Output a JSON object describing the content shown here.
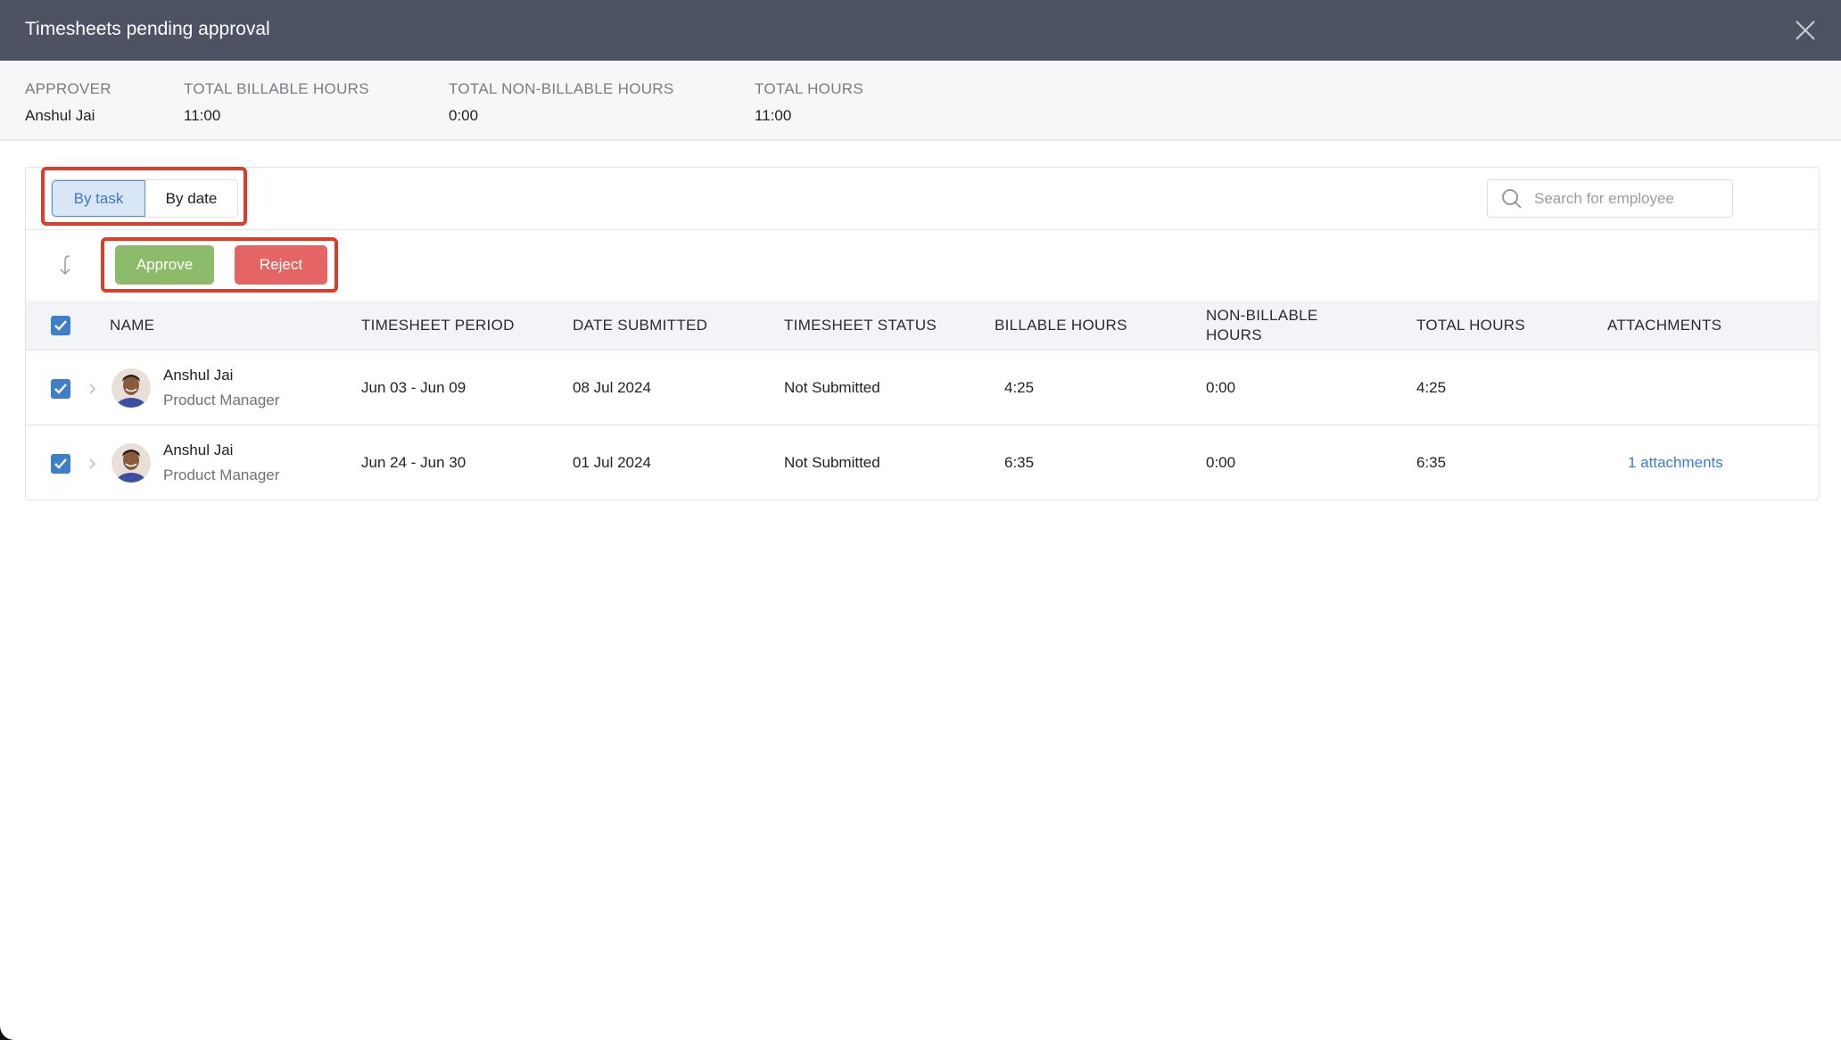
{
  "dialog": {
    "title": "Timesheets pending approval",
    "close_icon": "close-icon"
  },
  "summary": [
    {
      "label": "APPROVER",
      "value": "Anshul Jai"
    },
    {
      "label": "TOTAL BILLABLE HOURS",
      "value": "11:00"
    },
    {
      "label": "TOTAL NON-BILLABLE HOURS",
      "value": "0:00"
    },
    {
      "label": "TOTAL HOURS",
      "value": "11:00"
    }
  ],
  "view_toggle": {
    "options": [
      "By task",
      "By date"
    ],
    "selected": "By task"
  },
  "search": {
    "placeholder": "Search for employee",
    "value": "",
    "icon": "search-icon"
  },
  "toolbar": {
    "sort_icon": "sort-arrow-icon",
    "approve_label": "Approve",
    "reject_label": "Reject",
    "approve_color": "#8cbb6a",
    "reject_color": "#e56564"
  },
  "highlight_color": "#e03a2b",
  "table": {
    "select_all_checked": true,
    "columns": [
      "NAME",
      "TIMESHEET PERIOD",
      "DATE SUBMITTED",
      "TIMESHEET STATUS",
      "BILLABLE HOURS",
      "NON-BILLABLE HOURS",
      "TOTAL HOURS",
      "ATTACHMENTS"
    ],
    "rows": [
      {
        "checked": true,
        "name": "Anshul Jai",
        "role": "Product Manager",
        "period": "Jun 03 - Jun 09",
        "date_submitted": "08 Jul 2024",
        "status": "Not Submitted",
        "billable": "4:25",
        "non_billable": "0:00",
        "total": "4:25",
        "attachments": ""
      },
      {
        "checked": true,
        "name": "Anshul Jai",
        "role": "Product Manager",
        "period": "Jun 24 - Jun 30",
        "date_submitted": "01 Jul 2024",
        "status": "Not Submitted",
        "billable": "6:35",
        "non_billable": "0:00",
        "total": "6:35",
        "attachments": "1 attachments"
      }
    ]
  }
}
